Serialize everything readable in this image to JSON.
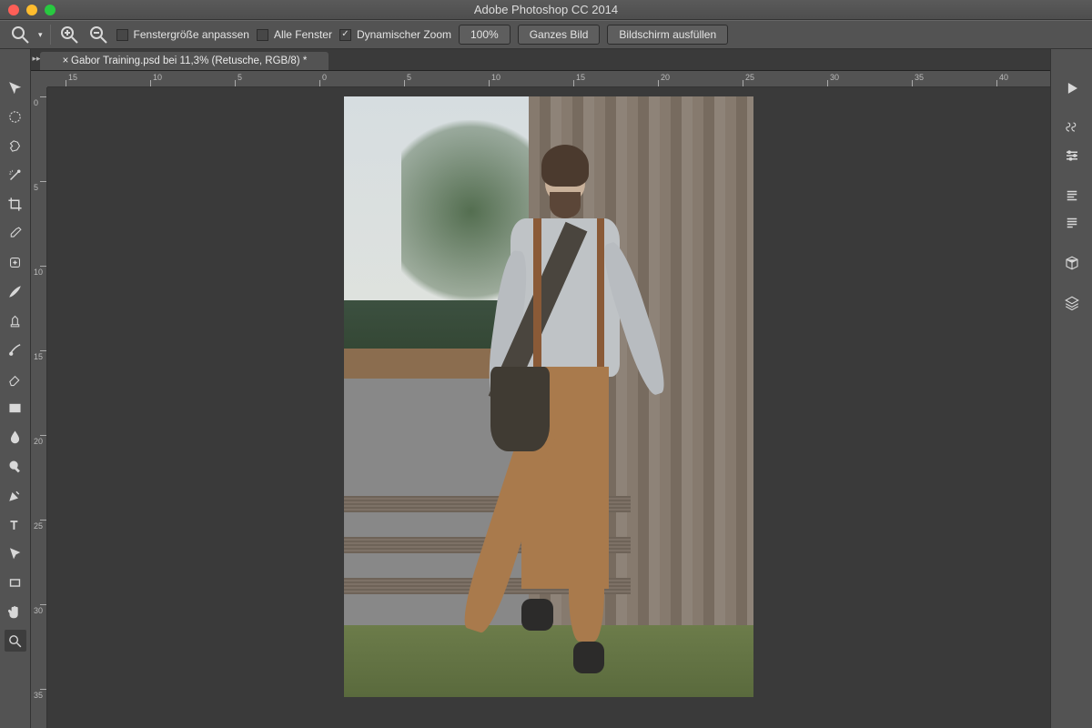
{
  "app_title": "Adobe Photoshop CC 2014",
  "options_bar": {
    "fit_window": "Fenstergröße anpassen",
    "all_windows": "Alle Fenster",
    "dynamic_zoom": "Dynamischer Zoom",
    "zoom_level": "100%",
    "whole_image": "Ganzes Bild",
    "fill_screen": "Bildschirm ausfüllen"
  },
  "document": {
    "tab_label": "Gabor Training.psd bei 11,3% (Retusche, RGB/8) *"
  },
  "ruler": {
    "h_labels": [
      "15",
      "10",
      "5",
      "0",
      "5",
      "10",
      "15",
      "20",
      "25",
      "30",
      "35",
      "40"
    ],
    "v_labels": [
      "0",
      "5",
      "10",
      "15",
      "20",
      "25",
      "30",
      "35"
    ]
  },
  "tools": [
    "move",
    "marquee",
    "lasso",
    "magic-wand",
    "crop",
    "eyedropper",
    "healing-brush",
    "brush",
    "clone-stamp",
    "history-brush",
    "eraser",
    "gradient",
    "blur",
    "dodge",
    "pen",
    "type",
    "path-select",
    "rectangle",
    "hand",
    "zoom"
  ],
  "active_tool": "zoom",
  "panels": [
    "play",
    "brushes",
    "adjustments",
    "paragraph",
    "character",
    "3d",
    "layers"
  ]
}
